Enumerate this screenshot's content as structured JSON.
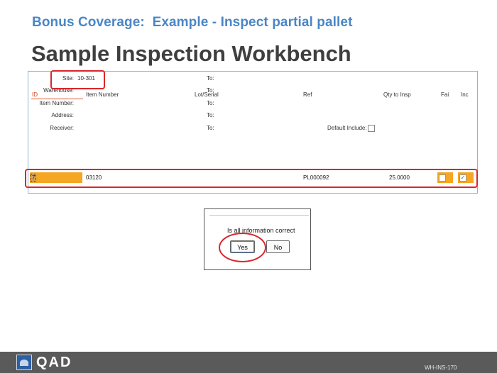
{
  "slide": {
    "subtitle": "Bonus Coverage:  Example - Inspect partial pallet",
    "title": "Sample Inspection Workbench",
    "code": "WH-INS-170",
    "logo": "QAD"
  },
  "form": {
    "site_label": "Site:",
    "site_value": "10-301",
    "warehouse_label": "Warehouse:",
    "item_number_label": "Item Number:",
    "address_label": "Address:",
    "receiver_label": "Receiver:",
    "to_label": "To:",
    "default_include_label": "Default Include:"
  },
  "table": {
    "headers": [
      "ID",
      "Item Number",
      "Lot/Serial",
      "Ref",
      "Qty to Insp",
      "Fai",
      "Inc"
    ],
    "rows": [
      {
        "id": "7",
        "item_number": "03120",
        "lot_serial": "",
        "ref": "PL000092",
        "qty": "25.0000",
        "fail": false,
        "inc": true
      }
    ]
  },
  "dialog": {
    "question": "Is all information correct",
    "yes_label": "Yes",
    "no_label": "No"
  },
  "colors": {
    "accent_blue": "#4a86c5",
    "highlight_red": "#d9262b",
    "field_orange": "#f5a623",
    "footer_gray": "#5a5a5a"
  }
}
